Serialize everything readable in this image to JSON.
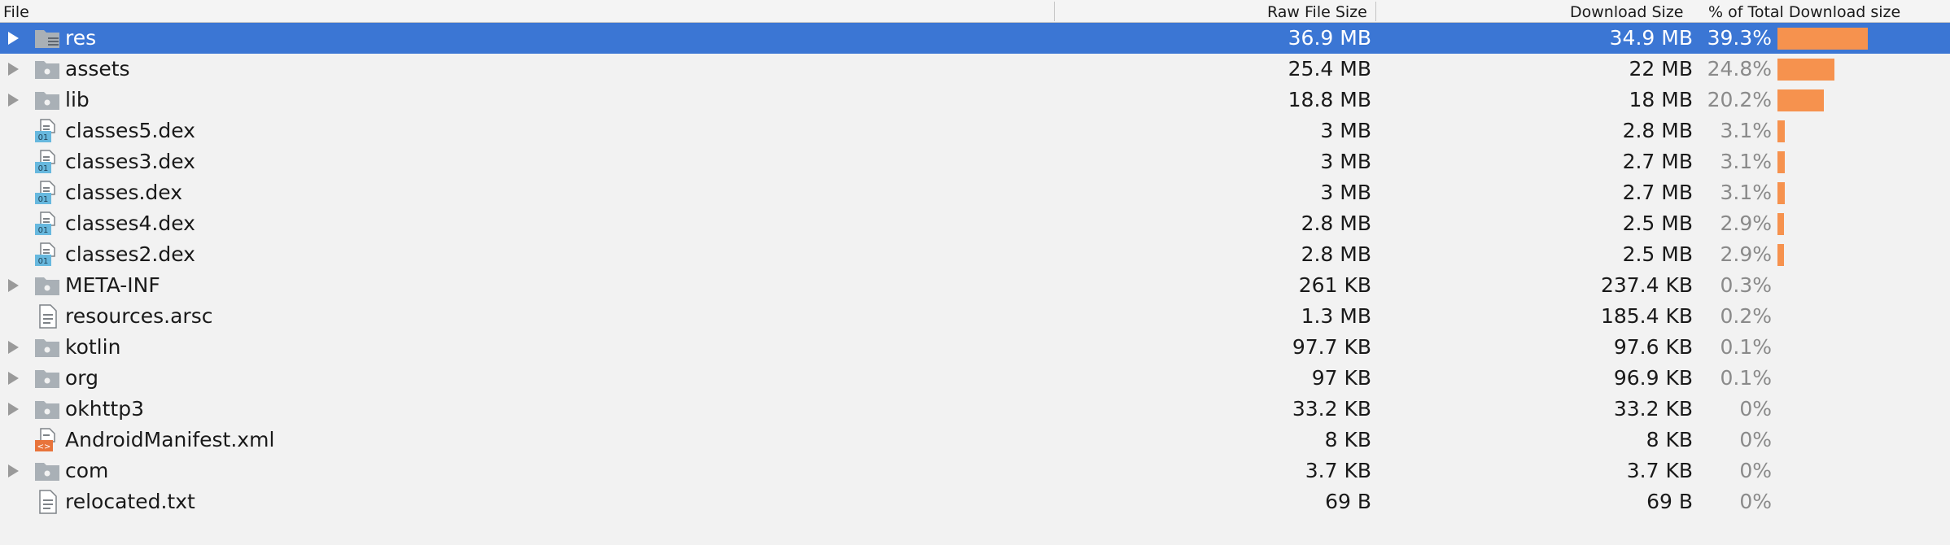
{
  "columns": {
    "file": "File",
    "raw": "Raw File Size",
    "download": "Download Size",
    "percent": "% of Total Download size"
  },
  "rows": [
    {
      "name": "res",
      "raw": "36.9 MB",
      "download": "34.9 MB",
      "percent": "39.3%",
      "share": 39.3,
      "type": "folder-res",
      "expandable": true,
      "selected": true
    },
    {
      "name": "assets",
      "raw": "25.4 MB",
      "download": "22 MB",
      "percent": "24.8%",
      "share": 24.8,
      "type": "folder",
      "expandable": true
    },
    {
      "name": "lib",
      "raw": "18.8 MB",
      "download": "18 MB",
      "percent": "20.2%",
      "share": 20.2,
      "type": "folder",
      "expandable": true
    },
    {
      "name": "classes5.dex",
      "raw": "3 MB",
      "download": "2.8 MB",
      "percent": "3.1%",
      "share": 3.1,
      "type": "dex"
    },
    {
      "name": "classes3.dex",
      "raw": "3 MB",
      "download": "2.7 MB",
      "percent": "3.1%",
      "share": 3.1,
      "type": "dex"
    },
    {
      "name": "classes.dex",
      "raw": "3 MB",
      "download": "2.7 MB",
      "percent": "3.1%",
      "share": 3.1,
      "type": "dex"
    },
    {
      "name": "classes4.dex",
      "raw": "2.8 MB",
      "download": "2.5 MB",
      "percent": "2.9%",
      "share": 2.9,
      "type": "dex"
    },
    {
      "name": "classes2.dex",
      "raw": "2.8 MB",
      "download": "2.5 MB",
      "percent": "2.9%",
      "share": 2.9,
      "type": "dex"
    },
    {
      "name": "META-INF",
      "raw": "261 KB",
      "download": "237.4 KB",
      "percent": "0.3%",
      "share": 0.3,
      "type": "folder",
      "expandable": true
    },
    {
      "name": "resources.arsc",
      "raw": "1.3 MB",
      "download": "185.4 KB",
      "percent": "0.2%",
      "share": 0.2,
      "type": "file"
    },
    {
      "name": "kotlin",
      "raw": "97.7 KB",
      "download": "97.6 KB",
      "percent": "0.1%",
      "share": 0.1,
      "type": "folder",
      "expandable": true
    },
    {
      "name": "org",
      "raw": "97 KB",
      "download": "96.9 KB",
      "percent": "0.1%",
      "share": 0.1,
      "type": "folder",
      "expandable": true
    },
    {
      "name": "okhttp3",
      "raw": "33.2 KB",
      "download": "33.2 KB",
      "percent": "0%",
      "share": 0,
      "type": "folder",
      "expandable": true
    },
    {
      "name": "AndroidManifest.xml",
      "raw": "8 KB",
      "download": "8 KB",
      "percent": "0%",
      "share": 0,
      "type": "xml"
    },
    {
      "name": "com",
      "raw": "3.7 KB",
      "download": "3.7 KB",
      "percent": "0%",
      "share": 0,
      "type": "folder",
      "expandable": true
    },
    {
      "name": "relocated.txt",
      "raw": "69 B",
      "download": "69 B",
      "percent": "0%",
      "share": 0,
      "type": "file"
    }
  ],
  "colors": {
    "selection": "#3b76d4",
    "bar": "#f6924e",
    "folder": "#a9b0b6",
    "dex_badge": "#67b8de",
    "xml_badge": "#e8743b"
  }
}
